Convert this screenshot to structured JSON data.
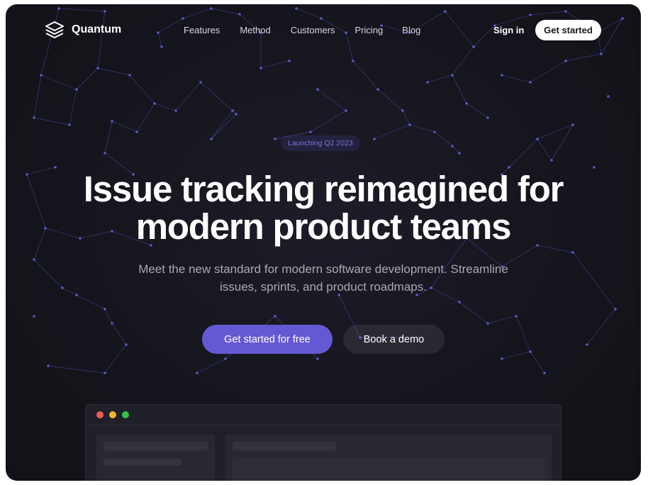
{
  "brand": {
    "name": "Quantum",
    "icon": "layers-icon"
  },
  "nav": {
    "links": [
      "Features",
      "Method",
      "Customers",
      "Pricing",
      "Blog"
    ],
    "sign_in": "Sign in",
    "get_started": "Get started"
  },
  "hero": {
    "badge": "Launching Q2 2023",
    "title_line1": "Issue tracking reimagined for",
    "title_line2": "modern product teams",
    "subtitle_line1": "Meet the new standard for modern software development. Streamline",
    "subtitle_line2": "issues, sprints, and product roadmaps.",
    "primary_cta": "Get started for free",
    "secondary_cta": "Book a demo"
  },
  "colors": {
    "background": "#15151d",
    "accent": "#6459d2",
    "badge_text": "#7b72e6",
    "network": "#5b52c9"
  }
}
